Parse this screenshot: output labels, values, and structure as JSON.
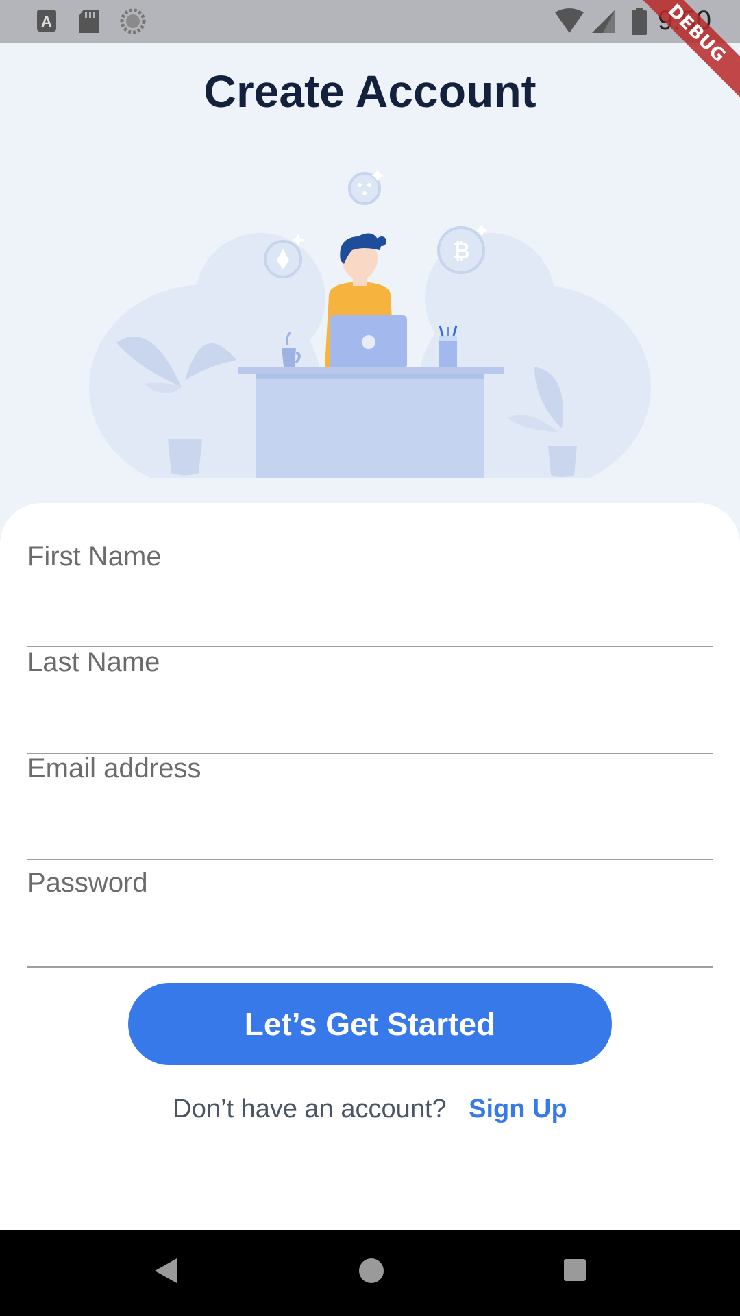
{
  "status_bar": {
    "time": "9:50",
    "left_icons": [
      "keyboard-a-icon",
      "sd-card-icon",
      "loading-circle-icon"
    ],
    "right_icons": [
      "wifi-icon",
      "cell-signal-icon",
      "battery-icon"
    ],
    "debug_banner": "DEBUG"
  },
  "page": {
    "title": "Create Account"
  },
  "form": {
    "fields": [
      {
        "name": "first-name",
        "placeholder": "First Name",
        "value": ""
      },
      {
        "name": "last-name",
        "placeholder": "Last Name",
        "value": ""
      },
      {
        "name": "email",
        "placeholder": "Email address",
        "value": ""
      },
      {
        "name": "password",
        "placeholder": "Password",
        "value": ""
      }
    ],
    "submit_label": "Let’s Get Started"
  },
  "footer": {
    "prompt": "Don’t have an account?",
    "link": "Sign Up"
  },
  "nav_bar": {
    "icons": [
      "back-icon",
      "home-icon",
      "recents-icon"
    ]
  },
  "colors": {
    "primary": "#3879EA",
    "title": "#14213D",
    "background": "#EEF2F9",
    "card": "#FFFFFF"
  }
}
